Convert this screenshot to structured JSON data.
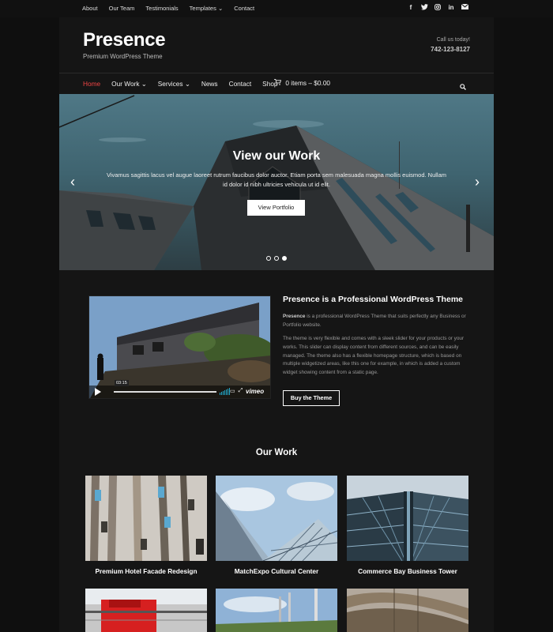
{
  "topbar": {
    "links": [
      "About",
      "Our Team",
      "Testimonials",
      "Templates ⌄",
      "Contact"
    ],
    "social_icons": [
      "facebook-icon",
      "twitter-icon",
      "instagram-icon",
      "linkedin-icon",
      "email-icon"
    ]
  },
  "header": {
    "site_title": "Presence",
    "tagline": "Premium WordPress Theme",
    "call_label": "Call us today!",
    "phone": "742-123-8127"
  },
  "nav": {
    "items": [
      "Home",
      "Our Work ⌄",
      "Services ⌄",
      "News",
      "Contact",
      "Shop"
    ],
    "cart": "0 items – $0.00"
  },
  "hero": {
    "title": "View our Work",
    "text": "Vivamus sagittis lacus vel augue laoreet rutrum faucibus dolor auctor. Etiam porta sem malesuada magna mollis euismod. Nullam id dolor id nibh ultricies vehicula ut id elit.",
    "button": "View Portfolio",
    "prev": "‹",
    "next": "›",
    "active_slide": 3
  },
  "video": {
    "time": "03:15",
    "brand": "vimeo"
  },
  "intro": {
    "title": "Presence is a Professional WordPress Theme",
    "p1_bold": "Presence",
    "p1_rest": " is a professional WordPress Theme that suits perfectly any Business or Portfolio website.",
    "p2": "The theme is very flexible and comes with a sleek slider for your products or your works. This slider can display content from different sources, and can be easily managed. The theme also has a flexible homepage structure, which is based on multiple widgetized areas, like this one for example, in which is added a custom widget showing content from a static page.",
    "button": "Buy the Theme"
  },
  "work": {
    "title": "Our Work",
    "items": [
      {
        "caption": "Premium Hotel Facade Redesign"
      },
      {
        "caption": "MatchExpo Cultural Center"
      },
      {
        "caption": "Commerce Bay Business Tower"
      }
    ]
  },
  "colors": {
    "accent": "#e44444",
    "page_bg": "#151515",
    "outer_bg": "#0f0f0f"
  }
}
